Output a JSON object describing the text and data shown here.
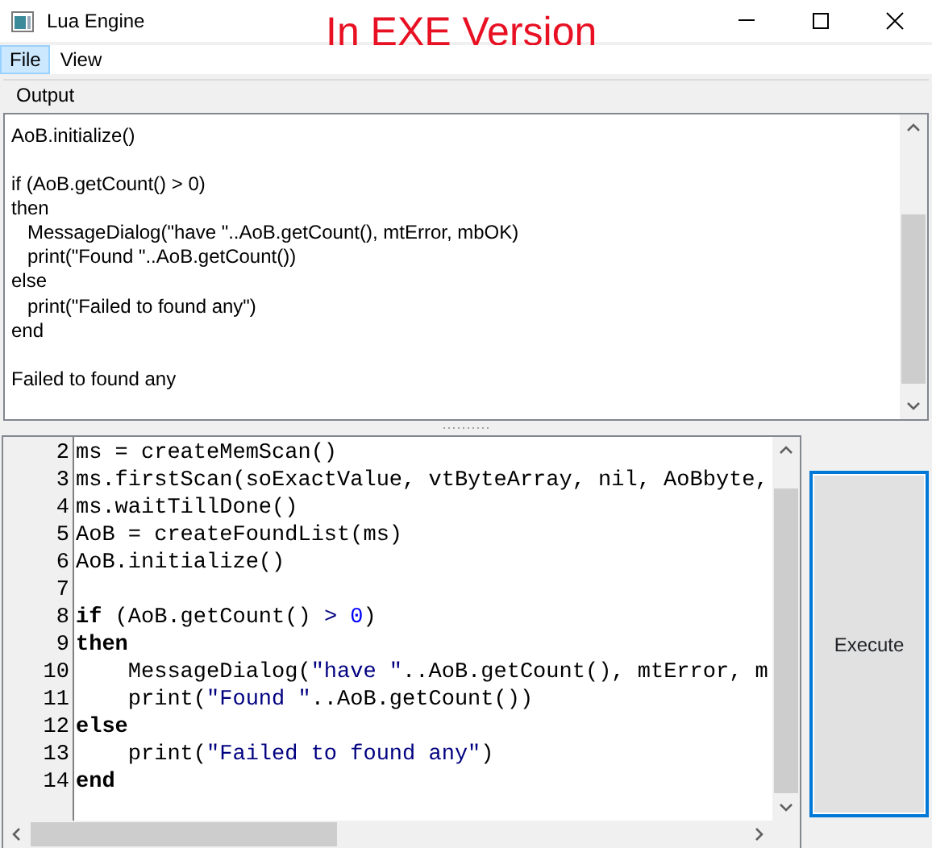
{
  "window": {
    "title": "Lua Engine"
  },
  "annotation": "In EXE Version",
  "menu": [
    {
      "label": "File",
      "selected": true
    },
    {
      "label": "View",
      "selected": false
    }
  ],
  "output": {
    "label": "Output",
    "blocks": [
      [
        "AoB.initialize()"
      ],
      [
        "if (AoB.getCount() > 0)",
        "then",
        "   MessageDialog(\"have \"..AoB.getCount(), mtError, mbOK)",
        "   print(\"Found \"..AoB.getCount())",
        "else",
        "   print(\"Failed to found any\")",
        "end"
      ],
      [
        "Failed to found any"
      ]
    ]
  },
  "editor": {
    "lines": [
      {
        "number": "2",
        "segments": [
          {
            "kind": "plain",
            "text": "ms = createMemScan()"
          }
        ]
      },
      {
        "number": "3",
        "segments": [
          {
            "kind": "plain",
            "text": "ms.firstScan(soExactValue, vtByteArray, nil, AoBbyte,"
          }
        ]
      },
      {
        "number": "4",
        "segments": [
          {
            "kind": "plain",
            "text": "ms.waitTillDone()"
          }
        ]
      },
      {
        "number": "5",
        "segments": [
          {
            "kind": "plain",
            "text": "AoB = createFoundList(ms)"
          }
        ]
      },
      {
        "number": "6",
        "segments": [
          {
            "kind": "plain",
            "text": "AoB.initialize()"
          }
        ]
      },
      {
        "number": "7"
      },
      {
        "number": "8",
        "segments": [
          {
            "kind": "keyword",
            "text": "if"
          },
          {
            "kind": "plain",
            "text": " (AoB.getCount() "
          },
          {
            "kind": "operator",
            "text": "> "
          },
          {
            "kind": "number",
            "text": "0"
          },
          {
            "kind": "plain",
            "text": ")"
          }
        ]
      },
      {
        "number": "9",
        "segments": [
          {
            "kind": "keyword",
            "text": "then"
          }
        ]
      },
      {
        "number": "10",
        "segments": [
          {
            "kind": "plain",
            "text": "    MessageDialog("
          },
          {
            "kind": "string",
            "text": "\"have \""
          },
          {
            "kind": "plain",
            "text": "..AoB.getCount(), mtError, m"
          }
        ]
      },
      {
        "number": "11",
        "segments": [
          {
            "kind": "plain",
            "text": "    print("
          },
          {
            "kind": "string",
            "text": "\"Found \""
          },
          {
            "kind": "plain",
            "text": "..AoB.getCount())"
          }
        ]
      },
      {
        "number": "12",
        "segments": [
          {
            "kind": "keyword",
            "text": "else"
          }
        ]
      },
      {
        "number": "13",
        "segments": [
          {
            "kind": "plain",
            "text": "    print("
          },
          {
            "kind": "string",
            "text": "\"Failed to found any\""
          },
          {
            "kind": "plain",
            "text": ")"
          }
        ]
      },
      {
        "number": "14",
        "segments": [
          {
            "kind": "keyword",
            "text": "end"
          }
        ]
      }
    ]
  },
  "execute_button": {
    "label": "Execute",
    "focused": true
  }
}
